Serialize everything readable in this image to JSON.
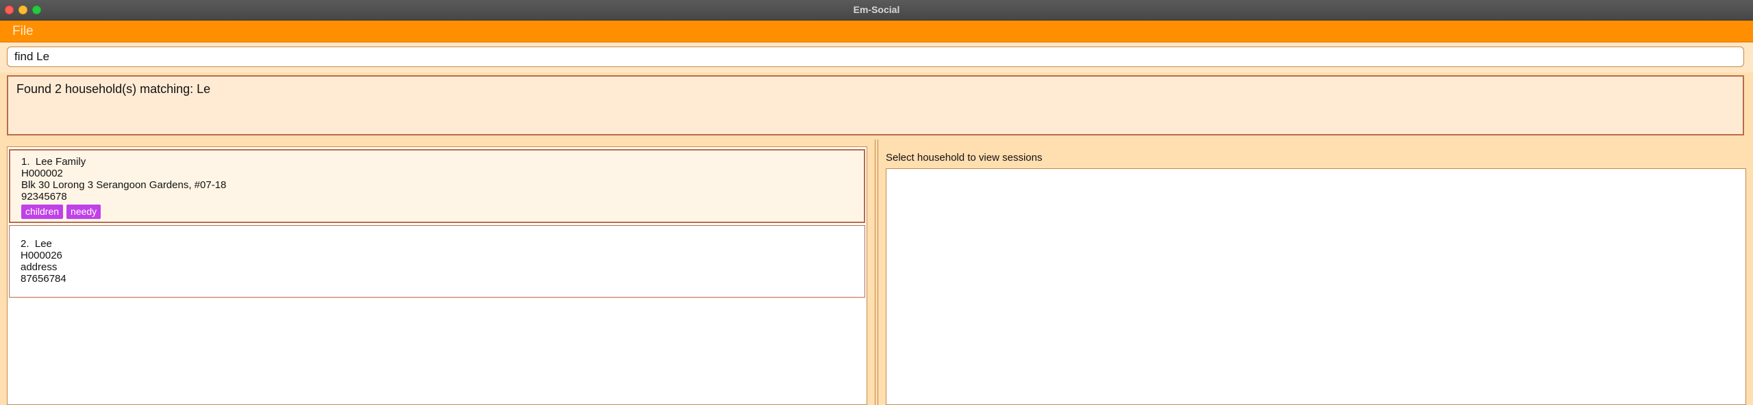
{
  "window": {
    "title": "Em-Social"
  },
  "menu": {
    "file_label": "File"
  },
  "command": {
    "value": "find Le"
  },
  "result": {
    "text": "Found 2 household(s) matching: Le"
  },
  "households": [
    {
      "index": "1.",
      "name": "Lee Family",
      "id": "H000002",
      "address": "Blk 30 Lorong 3 Serangoon Gardens, #07-18",
      "phone": "92345678",
      "tags": [
        "children",
        "needy"
      ]
    },
    {
      "index": "2.",
      "name": "Lee",
      "id": "H000026",
      "address": "address",
      "phone": "87656784",
      "tags": []
    }
  ],
  "sessions": {
    "placeholder_label": "Select household to view sessions"
  },
  "colors": {
    "menu": "#ff8f00",
    "tag": "#c041e8",
    "panel": "#ffdeb0"
  }
}
